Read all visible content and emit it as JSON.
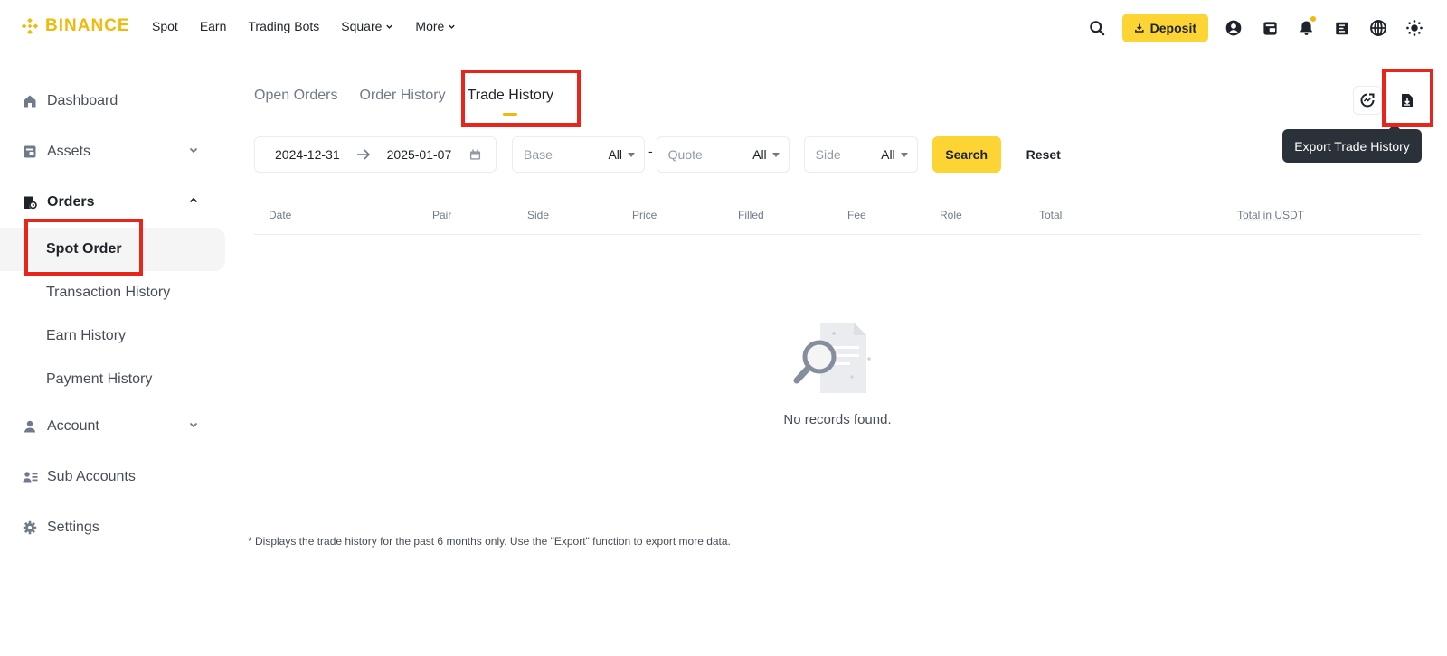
{
  "brand": {
    "name": "BINANCE",
    "color": "#F0B90B"
  },
  "nav": {
    "links": [
      {
        "label": "Spot",
        "dropdown": false
      },
      {
        "label": "Earn",
        "dropdown": false
      },
      {
        "label": "Trading Bots",
        "dropdown": false
      },
      {
        "label": "Square",
        "dropdown": true
      },
      {
        "label": "More",
        "dropdown": true
      }
    ],
    "deposit_label": "Deposit",
    "icons": [
      "search-icon",
      "download-icon",
      "user-icon",
      "wallet-icon",
      "bell-icon",
      "qr-scan-icon",
      "globe-icon",
      "theme-icon"
    ]
  },
  "sidebar": {
    "dashboard": "Dashboard",
    "assets": "Assets",
    "orders": "Orders",
    "orders_sub": [
      "Spot Order",
      "Transaction History",
      "Earn History",
      "Payment History"
    ],
    "account": "Account",
    "sub_accounts": "Sub Accounts",
    "settings": "Settings"
  },
  "tabs": [
    "Open Orders",
    "Order History",
    "Trade History"
  ],
  "active_tab": "Trade History",
  "filters": {
    "date_start": "2024-12-31",
    "date_end": "2025-01-07",
    "base_placeholder": "Base",
    "base_value": "All",
    "quote_placeholder": "Quote",
    "quote_value": "All",
    "side_placeholder": "Side",
    "side_value": "All",
    "separator": "-",
    "search_label": "Search",
    "reset_label": "Reset"
  },
  "tooltip": "Export Trade History",
  "table": {
    "columns": [
      "Date",
      "Pair",
      "Side",
      "Price",
      "Filled",
      "Fee",
      "Role",
      "Total",
      "Total in USDT"
    ],
    "rows": []
  },
  "empty_text": "No records found.",
  "footnote": "* Displays the trade history for the past 6 months only. Use the \"Export\" function to export more data.",
  "colors": {
    "accent": "#FCD535",
    "highlight": "#e8251b",
    "tooltip_bg": "#2b3139"
  }
}
